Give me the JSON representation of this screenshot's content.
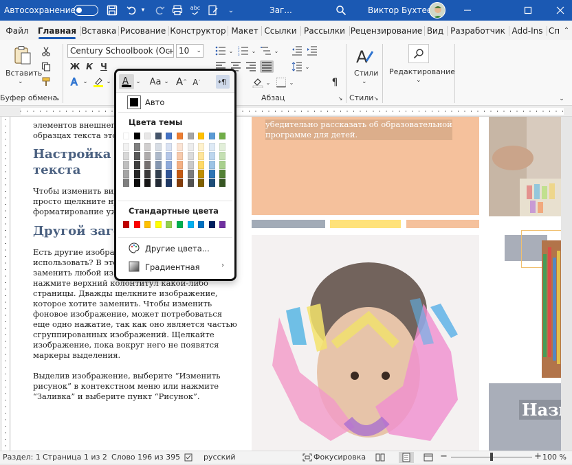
{
  "titlebar": {
    "autosave_label": "Автосохранение",
    "autosave_state": "off",
    "doc_title": "Заг...",
    "user_name": "Виктор Бухтеев"
  },
  "tabs": [
    "Файл",
    "Главная",
    "Вставка",
    "Рисование",
    "Конструктор",
    "Макет",
    "Ссылки",
    "Рассылки",
    "Рецензирование",
    "Вид",
    "Разработчик",
    "Add-Ins",
    "Сп"
  ],
  "active_tab": "Главная",
  "ribbon": {
    "paste_label": "Вставить",
    "clipboard_group": "Буфер обмена",
    "font_name": "Century Schoolbook (Осно",
    "font_size": "10",
    "bold": "Ж",
    "italic": "К",
    "underline": "Ч",
    "paragraph_group": "Абзац",
    "styles_label": "Стили",
    "styles_group": "Стили",
    "editing_label": "Редактирование",
    "grow_font": "A",
    "shrink_font": "A",
    "change_case": "Aa"
  },
  "font_color_menu": {
    "auto_label": "Авто",
    "theme_colors_label": "Цвета темы",
    "standard_colors_label": "Стандартные цвета",
    "more_colors_label": "Другие цвета...",
    "gradient_label": "Градиентная",
    "theme_colors": [
      [
        "#FFFFFF",
        "#000000",
        "#E7E6E6",
        "#44546A",
        "#4472C4",
        "#ED7D31",
        "#A5A5A5",
        "#FFC000",
        "#5B9BD5",
        "#70AD47"
      ],
      [
        "#F2F2F2",
        "#7F7F7F",
        "#D0CECE",
        "#D6DCE4",
        "#D9E2F3",
        "#FBE4D5",
        "#EDEDED",
        "#FFF2CC",
        "#DEEAF6",
        "#E2EFD9"
      ],
      [
        "#D8D8D8",
        "#595959",
        "#AEABAB",
        "#ADB9CA",
        "#B4C6E7",
        "#F7CAAC",
        "#DBDBDB",
        "#FFE599",
        "#BDD6EE",
        "#C5E0B3"
      ],
      [
        "#BFBFBF",
        "#3F3F3F",
        "#757070",
        "#8496B0",
        "#8EAADB",
        "#F4B083",
        "#C9C9C9",
        "#FFD966",
        "#9CC3E5",
        "#A8D08D"
      ],
      [
        "#A5A5A5",
        "#262626",
        "#3A3838",
        "#323F4F",
        "#2F5496",
        "#C45911",
        "#7B7B7B",
        "#BF8F00",
        "#2E75B5",
        "#538135"
      ],
      [
        "#7F7F7F",
        "#0C0C0C",
        "#171616",
        "#222A35",
        "#1F3864",
        "#833C0B",
        "#525252",
        "#7F6000",
        "#1E4E79",
        "#375623"
      ]
    ],
    "standard_colors": [
      "#C00000",
      "#FF0000",
      "#FFC000",
      "#FFFF00",
      "#92D050",
      "#00B050",
      "#00B0F0",
      "#0070C0",
      "#002060",
      "#7030A0"
    ]
  },
  "document": {
    "col1_lines_top": [
      "элементов внешнего вида",
      "образцах текста этого"
    ],
    "heading1": [
      "Настройка а",
      "текста"
    ],
    "para2": [
      "Чтобы изменить вид",
      "просто щелкните ну",
      "форматирование уж"
    ],
    "heading2": "Другой заго",
    "para3": [
      "Есть другие изобра",
      "использовать? В это",
      "заменить любой из рисунков. Просто дважды",
      "нажмите верхний колонтитул какой-либо",
      "страницы. Дважды щелкните изображение,",
      "которое хотите заменить. Чтобы изменить",
      "фоновое изображение, может потребоваться",
      "еще одно нажатие, так как оно является частью",
      "сгруппированных изображений. Щелкайте",
      "изображение, пока вокруг него не появятся",
      "маркеры выделения."
    ],
    "para4": [
      "Выделив изображение, выберите “Изменить",
      "рисунок” в контекстном меню или нажмите",
      "“Заливка” и выберите пункт “Рисунок”."
    ],
    "orange_text": [
      "убедительно рассказать об образовательной",
      "программе для детей."
    ],
    "right_heading": "Назн",
    "stripe_colors": [
      "#A2ABB7",
      "#FFE27A",
      "#F5C19C"
    ]
  },
  "statusbar": {
    "section": "Раздел: 1",
    "page": "Страница 1 из 2",
    "words": "Слово 196 из 395",
    "language": "русский",
    "focus": "Фокусировка",
    "zoom": "100 %",
    "zoom_percent": 100
  }
}
